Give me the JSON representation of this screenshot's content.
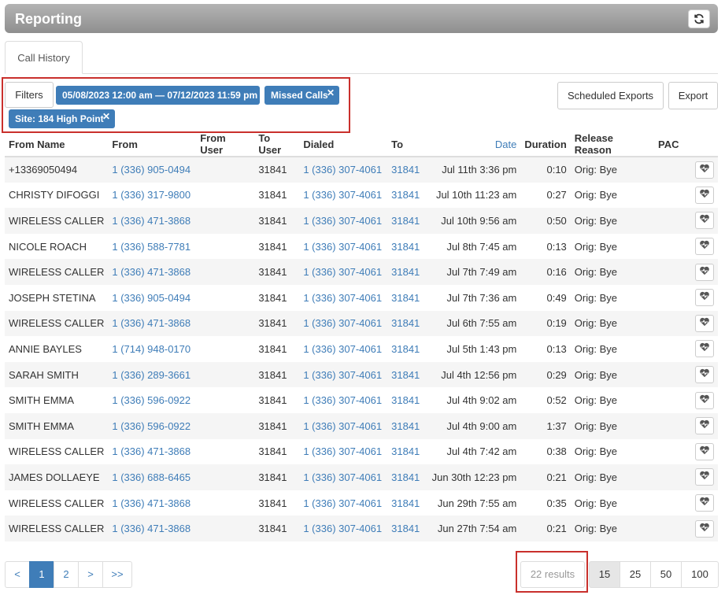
{
  "header": {
    "title": "Reporting"
  },
  "tabs": [
    {
      "label": "Call History"
    }
  ],
  "filters": {
    "button_label": "Filters",
    "chips": [
      {
        "label": "05/08/2023 12:00 am — 07/12/2023 11:59 pm",
        "closable": false
      },
      {
        "label": "Missed Calls",
        "closable": true
      },
      {
        "label": "Site: 184 High Point",
        "closable": true
      }
    ],
    "close_glyph": "✕"
  },
  "actions": {
    "scheduled_exports": "Scheduled Exports",
    "export": "Export"
  },
  "table": {
    "columns": [
      "From Name",
      "From",
      "From User",
      "To User",
      "Dialed",
      "To",
      "Date",
      "Duration",
      "Release Reason",
      "PAC"
    ],
    "rows": [
      {
        "from_name": "+13369050494",
        "from": "1 (336) 905-0494",
        "from_user": "",
        "to_user": "31841",
        "dialed": "1 (336) 307-4061",
        "to": "31841",
        "date": "Jul 11th 3:36 pm",
        "duration": "0:10",
        "release_reason": "Orig: Bye"
      },
      {
        "from_name": "CHRISTY DIFOGGI",
        "from": "1 (336) 317-9800",
        "from_user": "",
        "to_user": "31841",
        "dialed": "1 (336) 307-4061",
        "to": "31841",
        "date": "Jul 10th 11:23 am",
        "duration": "0:27",
        "release_reason": "Orig: Bye"
      },
      {
        "from_name": "WIRELESS CALLER",
        "from": "1 (336) 471-3868",
        "from_user": "",
        "to_user": "31841",
        "dialed": "1 (336) 307-4061",
        "to": "31841",
        "date": "Jul 10th 9:56 am",
        "duration": "0:50",
        "release_reason": "Orig: Bye"
      },
      {
        "from_name": "NICOLE ROACH",
        "from": "1 (336) 588-7781",
        "from_user": "",
        "to_user": "31841",
        "dialed": "1 (336) 307-4061",
        "to": "31841",
        "date": "Jul 8th 7:45 am",
        "duration": "0:13",
        "release_reason": "Orig: Bye"
      },
      {
        "from_name": "WIRELESS CALLER",
        "from": "1 (336) 471-3868",
        "from_user": "",
        "to_user": "31841",
        "dialed": "1 (336) 307-4061",
        "to": "31841",
        "date": "Jul 7th 7:49 am",
        "duration": "0:16",
        "release_reason": "Orig: Bye"
      },
      {
        "from_name": "JOSEPH STETINA",
        "from": "1 (336) 905-0494",
        "from_user": "",
        "to_user": "31841",
        "dialed": "1 (336) 307-4061",
        "to": "31841",
        "date": "Jul 7th 7:36 am",
        "duration": "0:49",
        "release_reason": "Orig: Bye"
      },
      {
        "from_name": "WIRELESS CALLER",
        "from": "1 (336) 471-3868",
        "from_user": "",
        "to_user": "31841",
        "dialed": "1 (336) 307-4061",
        "to": "31841",
        "date": "Jul 6th 7:55 am",
        "duration": "0:19",
        "release_reason": "Orig: Bye"
      },
      {
        "from_name": "ANNIE BAYLES",
        "from": "1 (714) 948-0170",
        "from_user": "",
        "to_user": "31841",
        "dialed": "1 (336) 307-4061",
        "to": "31841",
        "date": "Jul 5th 1:43 pm",
        "duration": "0:13",
        "release_reason": "Orig: Bye"
      },
      {
        "from_name": "SARAH SMITH",
        "from": "1 (336) 289-3661",
        "from_user": "",
        "to_user": "31841",
        "dialed": "1 (336) 307-4061",
        "to": "31841",
        "date": "Jul 4th 12:56 pm",
        "duration": "0:29",
        "release_reason": "Orig: Bye"
      },
      {
        "from_name": "SMITH EMMA",
        "from": "1 (336) 596-0922",
        "from_user": "",
        "to_user": "31841",
        "dialed": "1 (336) 307-4061",
        "to": "31841",
        "date": "Jul 4th 9:02 am",
        "duration": "0:52",
        "release_reason": "Orig: Bye"
      },
      {
        "from_name": "SMITH EMMA",
        "from": "1 (336) 596-0922",
        "from_user": "",
        "to_user": "31841",
        "dialed": "1 (336) 307-4061",
        "to": "31841",
        "date": "Jul 4th 9:00 am",
        "duration": "1:37",
        "release_reason": "Orig: Bye"
      },
      {
        "from_name": "WIRELESS CALLER",
        "from": "1 (336) 471-3868",
        "from_user": "",
        "to_user": "31841",
        "dialed": "1 (336) 307-4061",
        "to": "31841",
        "date": "Jul 4th 7:42 am",
        "duration": "0:38",
        "release_reason": "Orig: Bye"
      },
      {
        "from_name": "JAMES DOLLAEYE",
        "from": "1 (336) 688-6465",
        "from_user": "",
        "to_user": "31841",
        "dialed": "1 (336) 307-4061",
        "to": "31841",
        "date": "Jun 30th 12:23 pm",
        "duration": "0:21",
        "release_reason": "Orig: Bye"
      },
      {
        "from_name": "WIRELESS CALLER",
        "from": "1 (336) 471-3868",
        "from_user": "",
        "to_user": "31841",
        "dialed": "1 (336) 307-4061",
        "to": "31841",
        "date": "Jun 29th 7:55 am",
        "duration": "0:35",
        "release_reason": "Orig: Bye"
      },
      {
        "from_name": "WIRELESS CALLER",
        "from": "1 (336) 471-3868",
        "from_user": "",
        "to_user": "31841",
        "dialed": "1 (336) 307-4061",
        "to": "31841",
        "date": "Jun 27th 7:54 am",
        "duration": "0:21",
        "release_reason": "Orig: Bye"
      }
    ],
    "pac_icon": "heart-pulse-icon"
  },
  "pagination": {
    "pages": [
      "<",
      "1",
      "2",
      ">",
      ">>"
    ],
    "active": "1",
    "results_text": "22 results",
    "page_sizes": [
      "15",
      "25",
      "50",
      "100"
    ],
    "active_size": "15"
  },
  "colors": {
    "accent": "#3f7db8",
    "highlight_border": "#c9302c",
    "header_gray": "#9e9e9e"
  }
}
